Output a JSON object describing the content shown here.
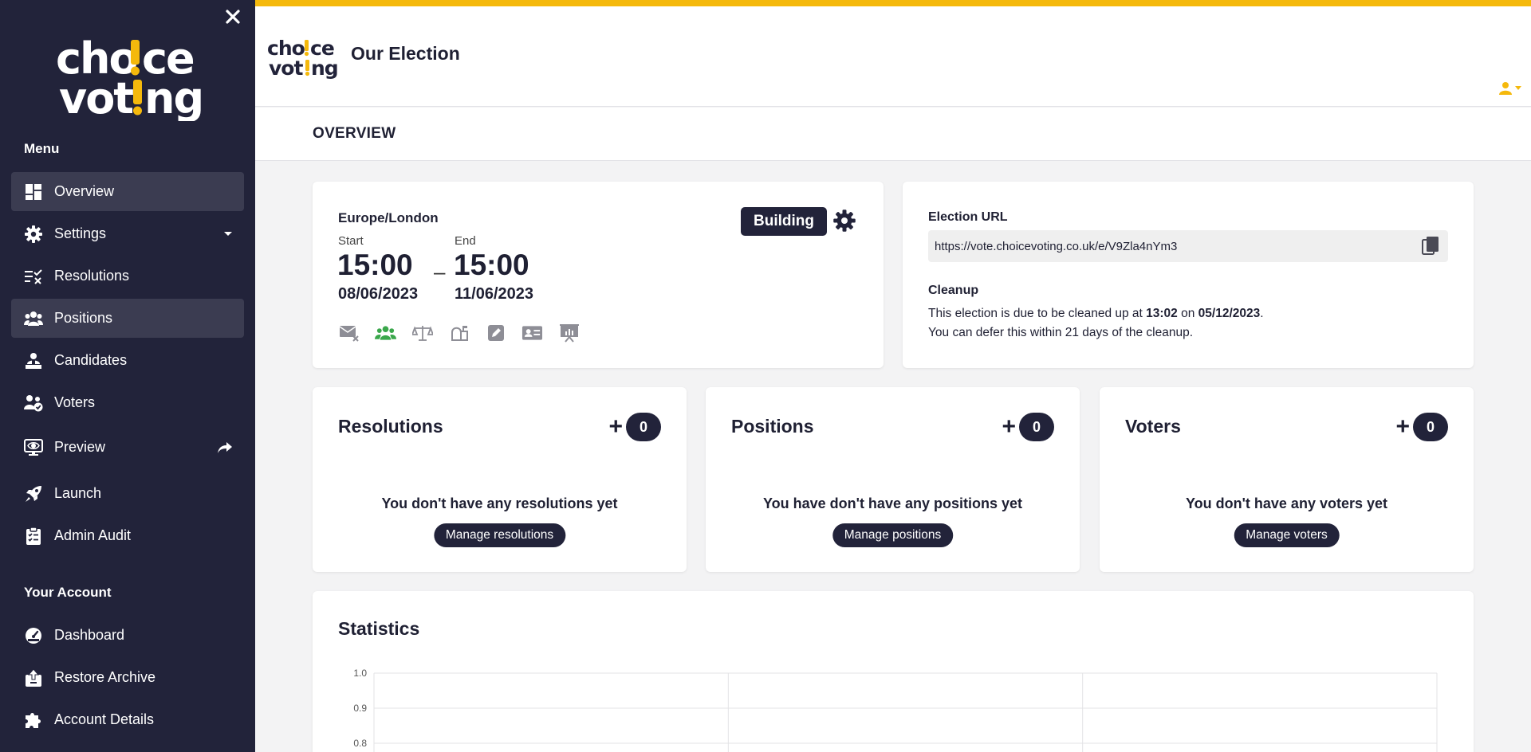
{
  "app": {
    "logo_text_line1": "cho!ce",
    "logo_text_line2": "vot!ng",
    "title": "Our Election",
    "accent_color": "#f5b90c",
    "dark_color": "#22233a"
  },
  "sidebar": {
    "menu_heading": "Menu",
    "items": [
      {
        "label": "Overview",
        "icon": "dashboard-icon"
      },
      {
        "label": "Settings",
        "icon": "gear-icon"
      },
      {
        "label": "Resolutions",
        "icon": "resolutions-icon"
      },
      {
        "label": "Positions",
        "icon": "people-icon"
      },
      {
        "label": "Candidates",
        "icon": "candidate-icon"
      },
      {
        "label": "Voters",
        "icon": "voters-icon"
      },
      {
        "label": "Preview",
        "icon": "preview-icon"
      },
      {
        "label": "Launch",
        "icon": "rocket-icon"
      },
      {
        "label": "Admin Audit",
        "icon": "clipboard-icon"
      }
    ],
    "account_heading": "Your Account",
    "account_items": [
      {
        "label": "Dashboard",
        "icon": "speedometer-icon"
      },
      {
        "label": "Restore Archive",
        "icon": "archive-upload-icon"
      },
      {
        "label": "Account Details",
        "icon": "puzzle-icon"
      }
    ]
  },
  "subheader": {
    "title": "OVERVIEW"
  },
  "election": {
    "timezone": "Europe/London",
    "start_label": "Start",
    "end_label": "End",
    "start_time": "15:00",
    "end_time": "15:00",
    "dash": "–",
    "start_date": "08/06/2023",
    "end_date": "11/06/2023",
    "status": "Building",
    "feature_icons": [
      "email-off-icon",
      "people-group-icon",
      "scales-icon",
      "mailbox-icon",
      "edit-icon",
      "id-card-icon",
      "presentation-icon"
    ]
  },
  "url_card": {
    "label": "Election URL",
    "url": "https://vote.choicevoting.co.uk/e/V9Zla4nYm3",
    "cleanup_label": "Cleanup",
    "cleanup_text_1": "This election is due to be cleaned up at ",
    "cleanup_time": "13:02",
    "cleanup_text_2": " on ",
    "cleanup_date": "05/12/2023",
    "cleanup_text_3": ".",
    "defer_text": "You can defer this within 21 days of the cleanup."
  },
  "summary": [
    {
      "title": "Resolutions",
      "plus": "+",
      "count": "0",
      "empty": "You don't have any resolutions yet",
      "button": "Manage resolutions"
    },
    {
      "title": "Positions",
      "plus": "+",
      "count": "0",
      "empty": "You have don't have any positions yet",
      "button": "Manage positions"
    },
    {
      "title": "Voters",
      "plus": "+",
      "count": "0",
      "empty": "You don't have any voters yet",
      "button": "Manage voters"
    }
  ],
  "statistics": {
    "title": "Statistics"
  },
  "chart_data": {
    "type": "line",
    "title": "",
    "xlabel": "",
    "ylabel": "",
    "yticks": [
      "1.0",
      "0.9",
      "0.8"
    ],
    "ylim": [
      0.8,
      1.0
    ],
    "grid": true,
    "series": []
  }
}
